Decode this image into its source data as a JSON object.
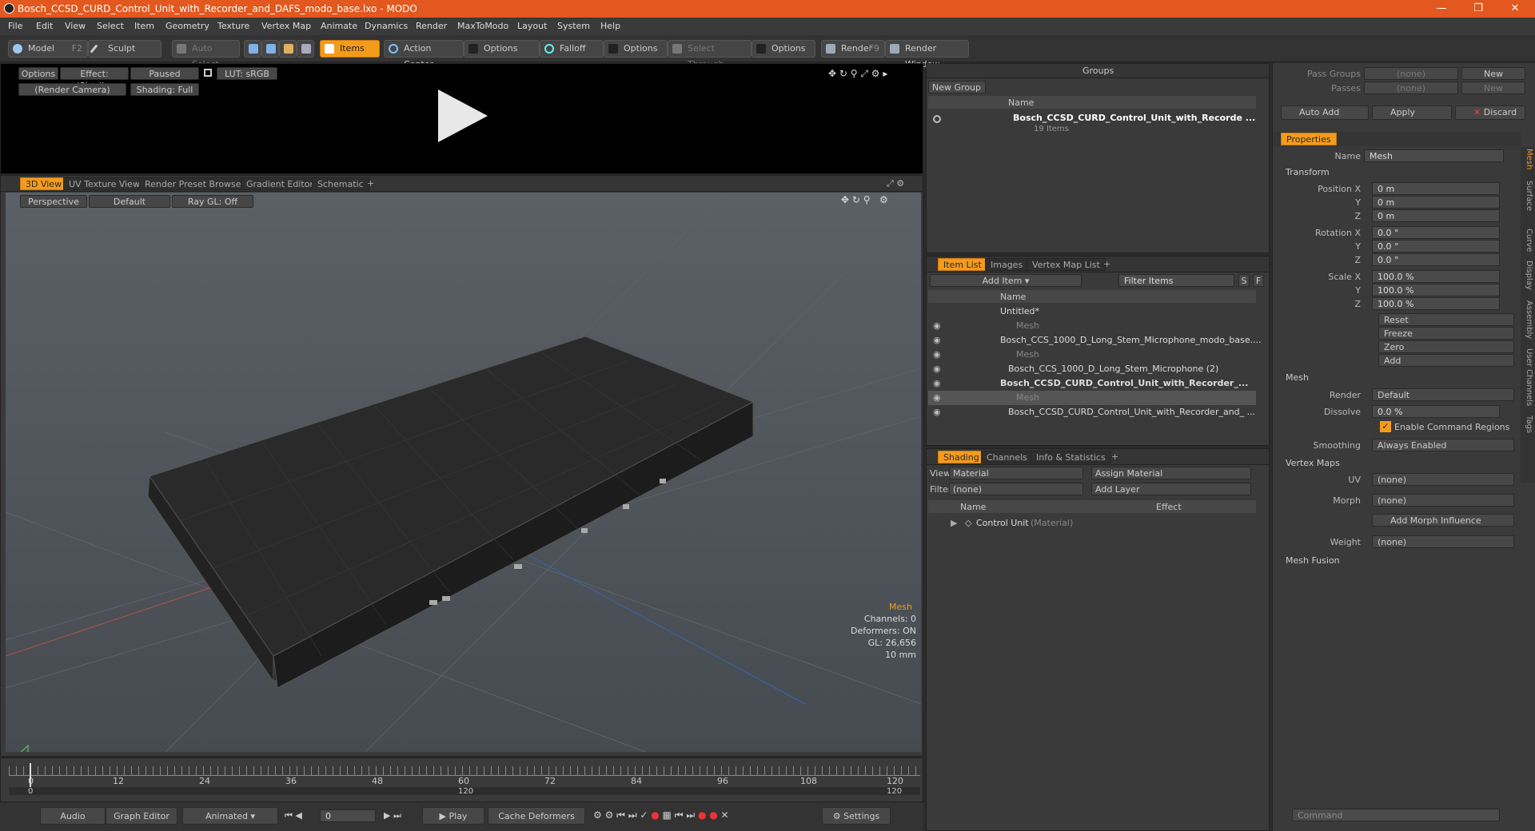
{
  "window": {
    "title": "Bosch_CCSD_CURD_Control_Unit_with_Recorder_and_DAFS_modo_base.lxo - MODO",
    "minimize": "—",
    "maximize": "❐",
    "close": "✕"
  },
  "menu": [
    "File",
    "Edit",
    "View",
    "Select",
    "Item",
    "Geometry",
    "Texture",
    "Vertex Map",
    "Animate",
    "Dynamics",
    "Render",
    "MaxToModo",
    "Layout",
    "System",
    "Help"
  ],
  "toolbar": {
    "model": "Model",
    "model_key": "F2",
    "sculpt": "Sculpt",
    "auto_select": "Auto Select",
    "items": "Items",
    "action_center": "Action Center",
    "options1": "Options",
    "falloff": "Falloff",
    "options2": "Options",
    "select_through": "Select Through",
    "options3": "Options",
    "render": "Render",
    "render_key": "F9",
    "render_window": "Render Window"
  },
  "preview": {
    "options": "Options",
    "effect": "Effect: (Shadi...",
    "paused": "Paused",
    "lut": "LUT: sRGB",
    "camera": "(Render Camera)",
    "shading": "Shading: Full"
  },
  "viewport": {
    "tabs": [
      "3D View",
      "UV Texture View",
      "Render Preset Browser",
      "Gradient Editor",
      "Schematic",
      "+"
    ],
    "perspective": "Perspective",
    "default": "Default",
    "raygl": "Ray GL: Off",
    "info": {
      "type": "Mesh",
      "channels": "Channels: 0",
      "deformers": "Deformers: ON",
      "gl": "GL: 26,656",
      "size": "10 mm"
    }
  },
  "timeline": {
    "ticks": [
      "0",
      "12",
      "24",
      "36",
      "48",
      "60",
      "72",
      "84",
      "96",
      "108",
      "120"
    ],
    "sub": [
      "0",
      "120",
      "120"
    ]
  },
  "transport": {
    "audio": "Audio",
    "graph": "Graph Editor",
    "animated": "Animated",
    "frame": "0",
    "play": "Play",
    "cache": "Cache Deformers",
    "settings": "Settings"
  },
  "groups": {
    "title": "Groups",
    "new_group": "New Group",
    "col_name": "Name",
    "item": "Bosch_CCSD_CURD_Control_Unit_with_Recorde ...",
    "count": "19 Items"
  },
  "itemlist": {
    "tabs": [
      "Item List",
      "Images",
      "Vertex Map List",
      "+"
    ],
    "add_item": "Add Item",
    "filter": "Filter Items",
    "s": "S",
    "f": "F",
    "col_name": "Name",
    "rows": [
      {
        "text": "Untitled*",
        "indent": 0,
        "bold": false,
        "dim": false
      },
      {
        "text": "Mesh",
        "indent": 2,
        "bold": false,
        "dim": true
      },
      {
        "text": "Bosch_CCS_1000_D_Long_Stem_Microphone_modo_base....",
        "indent": 0,
        "bold": false,
        "dim": false
      },
      {
        "text": "Mesh",
        "indent": 2,
        "bold": false,
        "dim": true
      },
      {
        "text": "Bosch_CCS_1000_D_Long_Stem_Microphone (2)",
        "indent": 1,
        "bold": false,
        "dim": false
      },
      {
        "text": "Bosch_CCSD_CURD_Control_Unit_with_Recorder_...",
        "indent": 0,
        "bold": true,
        "dim": false
      },
      {
        "text": "Mesh",
        "indent": 2,
        "bold": false,
        "dim": true
      },
      {
        "text": "Bosch_CCSD_CURD_Control_Unit_with_Recorder_and_ ...",
        "indent": 1,
        "bold": false,
        "dim": false
      }
    ]
  },
  "shading": {
    "tabs": [
      "Shading",
      "Channels",
      "Info & Statistics",
      "+"
    ],
    "view_label": "View",
    "view": "Material",
    "assign": "Assign Material",
    "filter_label": "Filter",
    "filter": "(none)",
    "add_layer": "Add Layer",
    "col_name": "Name",
    "col_effect": "Effect",
    "item": "Control Unit",
    "item_type": "(Material)"
  },
  "right": {
    "pass_groups": "Pass Groups",
    "passes": "Passes",
    "none": "(none)",
    "new": "New",
    "auto_add": "Auto Add",
    "apply": "Apply",
    "discard": "Discard",
    "properties": "Properties",
    "name_label": "Name",
    "name": "Mesh",
    "transform": "Transform",
    "position_x": "Position X",
    "pos": [
      "0 m",
      "0 m",
      "0 m"
    ],
    "rotation_x": "Rotation X",
    "rot": [
      "0.0 °",
      "0.0 °",
      "0.0 °"
    ],
    "scale_x": "Scale X",
    "scl": [
      "100.0 %",
      "100.0 %",
      "100.0 %"
    ],
    "y": "Y",
    "z": "Z",
    "reset": "Reset",
    "freeze": "Freeze",
    "zero": "Zero",
    "add": "Add",
    "mesh": "Mesh",
    "render_label": "Render",
    "render": "Default",
    "dissolve_label": "Dissolve",
    "dissolve": "0.0 %",
    "enable_cmd": "Enable Command Regions",
    "smoothing_label": "Smoothing",
    "smoothing": "Always Enabled",
    "vertex_maps": "Vertex Maps",
    "uv_label": "UV",
    "uv": "(none)",
    "morph_label": "Morph",
    "morph": "(none)",
    "add_morph": "Add Morph Influence",
    "weight_label": "Weight",
    "weight": "(none)",
    "mesh_fusion": "Mesh Fusion",
    "command": "Command",
    "vtabs": [
      "Mesh",
      "Surface",
      "Curve",
      "Display",
      "Assembly",
      "User Channels",
      "Tags"
    ]
  },
  "colors": {
    "accent": "#f49b1c",
    "title": "#e2581e"
  }
}
